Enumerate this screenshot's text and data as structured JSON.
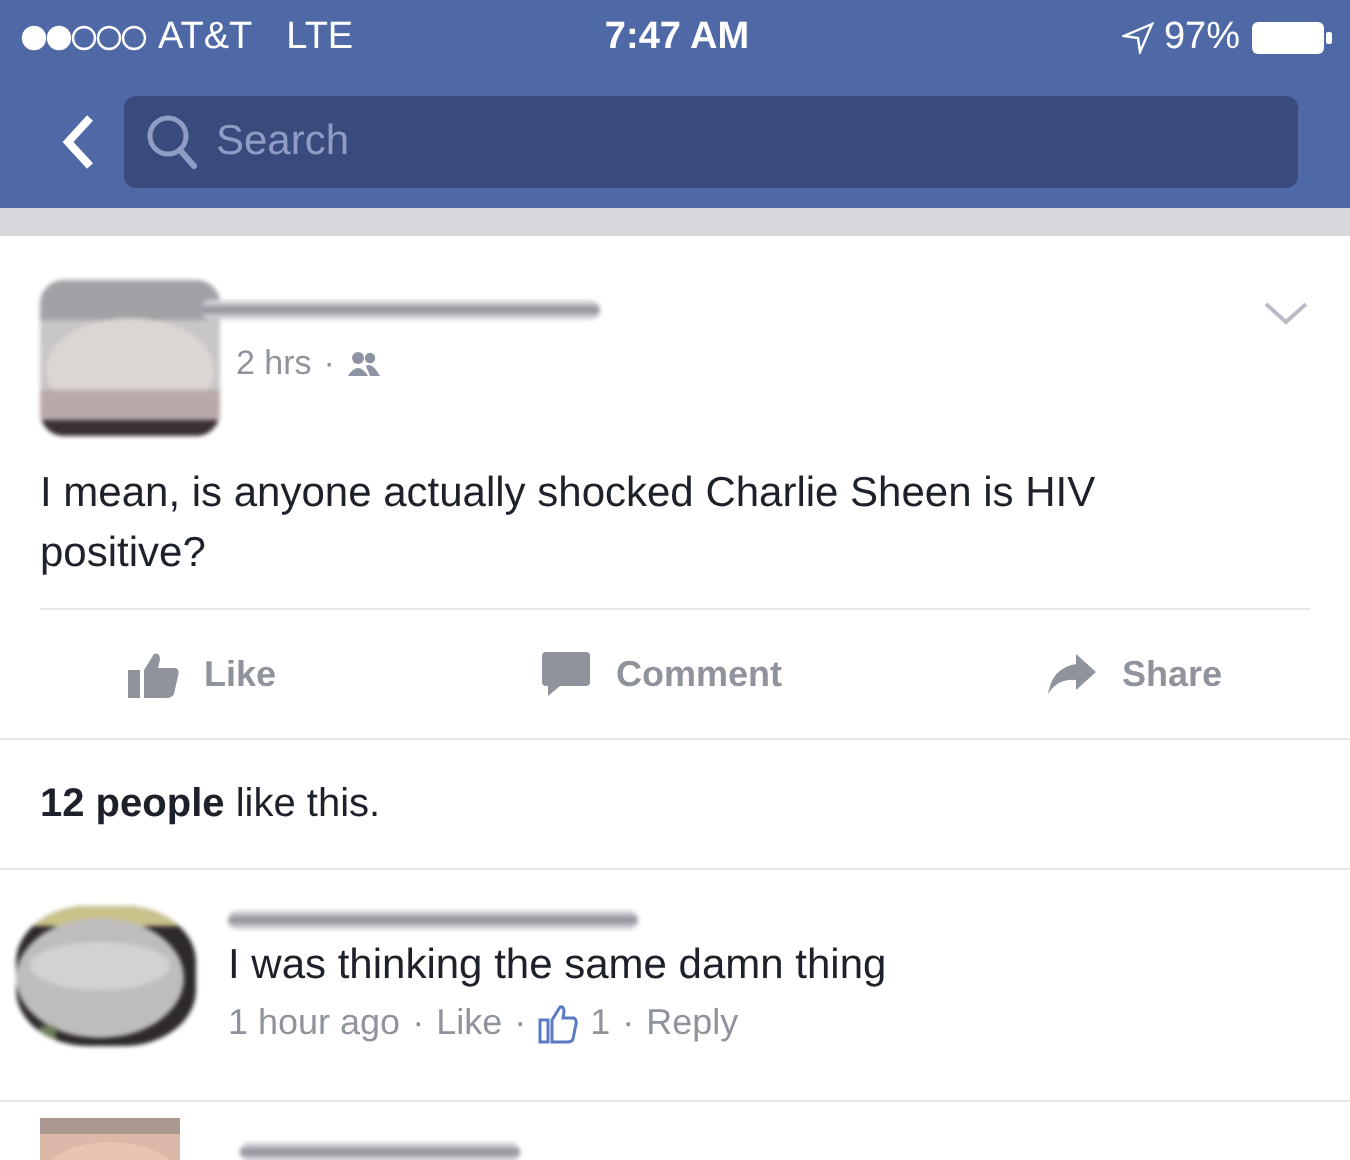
{
  "status_bar": {
    "carrier": "AT&T",
    "network": "LTE",
    "time": "7:47 AM",
    "battery": "97%"
  },
  "nav": {
    "search": {
      "placeholder": "Search"
    }
  },
  "post": {
    "time": "2 hrs",
    "separator": "·",
    "text": "I mean, is anyone actually shocked Charlie Sheen is HIV positive?",
    "actions": [
      {
        "label": "Like",
        "kind": "like"
      },
      {
        "label": "Comment",
        "kind": "comment"
      },
      {
        "label": "Share",
        "kind": "share"
      }
    ],
    "likes": "**12 people** like this."
  },
  "comments": [
    {
      "text": "I was thinking the same damn thing",
      "time": "1 hour ago",
      "like": "Like",
      "count": "1",
      "reply": "Reply",
      "separator": "·"
    }
  ]
}
